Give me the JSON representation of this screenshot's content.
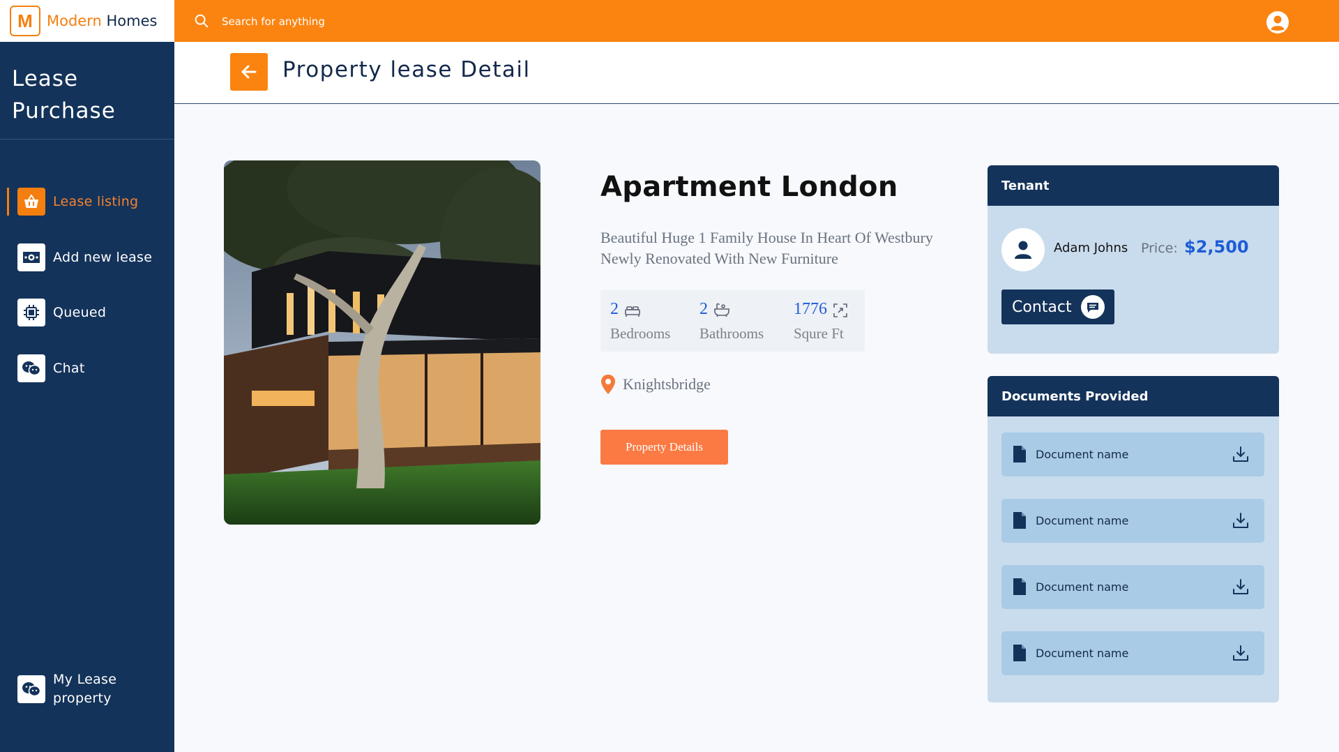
{
  "brand": {
    "mark": "M",
    "name_part1": "Modern",
    "name_part2": "Homes"
  },
  "search": {
    "placeholder": "Search for anything"
  },
  "sidebar": {
    "title": "Lease Purchase",
    "items": [
      {
        "label": "Lease listing",
        "icon": "basket-icon",
        "active": true
      },
      {
        "label": "Add new lease",
        "icon": "banknote-icon",
        "active": false
      },
      {
        "label": "Queued",
        "icon": "chip-icon",
        "active": false
      },
      {
        "label": "Chat",
        "icon": "chat-icon",
        "active": false
      }
    ],
    "bottom_item": {
      "label": "My Lease property",
      "icon": "chat-icon"
    }
  },
  "header": {
    "title": "Property lease Detail",
    "back_icon": "arrow-left-icon"
  },
  "property": {
    "name": "Apartment London",
    "description": "Beautiful Huge 1 Family House In Heart Of Westbury Newly Renovated With New Furniture",
    "stats": [
      {
        "value": "2",
        "label": "Bedrooms",
        "icon": "bed-icon"
      },
      {
        "value": "2",
        "label": "Bathrooms",
        "icon": "bathtub-icon"
      },
      {
        "value": "1776",
        "label": "Squre Ft",
        "icon": "expand-icon"
      }
    ],
    "location": "Knightsbridge",
    "details_button": "Property Details"
  },
  "tenant": {
    "heading": "Tenant",
    "name": "Adam Johns",
    "price_label": "Price:",
    "price": "$2,500",
    "contact_label": "Contact"
  },
  "documents": {
    "heading": "Documents Provided",
    "items": [
      "Document name",
      "Document name",
      "Document name",
      "Document name"
    ]
  },
  "colors": {
    "orange": "#fb8411",
    "navy": "#14335a",
    "blue_accent": "#1e5cd8",
    "card_bg": "#c9dced",
    "doc_row": "#a9cbe6",
    "cta": "#fb7a43"
  }
}
